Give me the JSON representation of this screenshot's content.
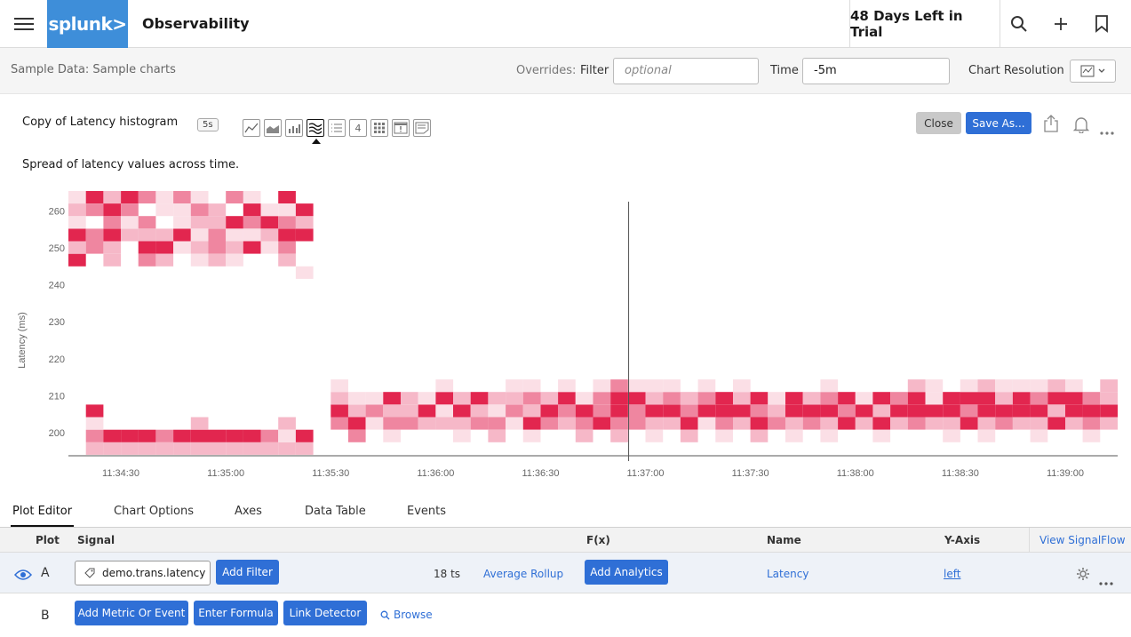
{
  "topbar": {
    "logo_text": "splunk>",
    "app_title": "Observability",
    "trial_text": "48 Days Left in Trial",
    "icons": [
      "menu-icon",
      "search-icon",
      "plus-icon",
      "bookmark-icon"
    ]
  },
  "subbar": {
    "breadcrumb": "Sample Data: Sample charts",
    "overrides_label": "Overrides:",
    "filter_label": "Filter",
    "filter_placeholder": "optional",
    "time_label": "Time",
    "time_value": "-5m",
    "resolution_label": "Chart Resolution"
  },
  "chart_header": {
    "title": "Copy of Latency histogram",
    "refresh_badge": "5s",
    "chart_types": [
      "line",
      "area",
      "column",
      "histogram",
      "list",
      "single-value",
      "heatmap",
      "event-feed",
      "text"
    ],
    "single_value_glyph": "4",
    "active_chart_type": "histogram",
    "description": "Spread of latency values across time.",
    "close_label": "Close",
    "save_as_label": "Save As..."
  },
  "chart_data": {
    "type": "heatmap",
    "title": "Copy of Latency histogram",
    "xlabel": "",
    "ylabel": "Latency (ms)",
    "ylim": [
      194,
      263
    ],
    "y_ticks": [
      200,
      210,
      220,
      230,
      240,
      250,
      260
    ],
    "x_ticks": [
      "11:34:30",
      "11:35:00",
      "11:35:30",
      "11:36:00",
      "11:36:30",
      "11:37:00",
      "11:37:30",
      "11:38:00",
      "11:38:30",
      "11:39:00"
    ],
    "start_time": "11:34:15",
    "bucket_seconds": 5,
    "bin_ms": 3.4,
    "bin_start_ms": 194,
    "cursor_time": "11:37:00",
    "color_scale": [
      "#ffffff",
      "#fbdfe6",
      "#f6b8c8",
      "#ef86a0",
      "#e2264f"
    ],
    "grid": false,
    "columns": [
      [
        0,
        0,
        0,
        0,
        0,
        0,
        0,
        0,
        0,
        0,
        0,
        0,
        0,
        0,
        0,
        4,
        2,
        4,
        1,
        2,
        1
      ],
      [
        2,
        3,
        1,
        4,
        0,
        0,
        0,
        0,
        0,
        0,
        0,
        0,
        0,
        0,
        0,
        0,
        3,
        3,
        0,
        3,
        4
      ],
      [
        2,
        4,
        0,
        0,
        0,
        0,
        0,
        0,
        0,
        0,
        0,
        0,
        0,
        0,
        0,
        2,
        2,
        4,
        3,
        4,
        2
      ],
      [
        2,
        4,
        0,
        0,
        0,
        0,
        0,
        0,
        0,
        0,
        0,
        0,
        0,
        0,
        0,
        0,
        0,
        2,
        1,
        3,
        4
      ],
      [
        2,
        4,
        0,
        0,
        0,
        0,
        0,
        0,
        0,
        0,
        0,
        0,
        0,
        0,
        0,
        3,
        4,
        2,
        3,
        0,
        3
      ],
      [
        2,
        3,
        0,
        0,
        0,
        0,
        0,
        0,
        0,
        0,
        0,
        0,
        0,
        0,
        0,
        2,
        4,
        2,
        0,
        1,
        1
      ],
      [
        2,
        4,
        0,
        0,
        0,
        0,
        0,
        0,
        0,
        0,
        0,
        0,
        0,
        0,
        0,
        0,
        1,
        4,
        1,
        1,
        3
      ],
      [
        2,
        4,
        2,
        0,
        0,
        0,
        0,
        0,
        0,
        0,
        0,
        0,
        0,
        0,
        0,
        1,
        2,
        1,
        2,
        3,
        1
      ],
      [
        2,
        4,
        0,
        0,
        0,
        0,
        0,
        0,
        0,
        0,
        0,
        0,
        0,
        0,
        0,
        2,
        3,
        3,
        2,
        2,
        0
      ],
      [
        2,
        4,
        0,
        0,
        0,
        0,
        0,
        0,
        0,
        0,
        0,
        0,
        0,
        0,
        0,
        1,
        2,
        1,
        4,
        0,
        3
      ],
      [
        2,
        4,
        0,
        0,
        0,
        0,
        0,
        0,
        0,
        0,
        0,
        0,
        0,
        0,
        0,
        0,
        4,
        1,
        3,
        4,
        1
      ],
      [
        2,
        3,
        0,
        0,
        0,
        0,
        0,
        0,
        0,
        0,
        0,
        0,
        0,
        0,
        0,
        0,
        1,
        2,
        4,
        1,
        0
      ],
      [
        2,
        1,
        2,
        0,
        0,
        0,
        0,
        0,
        0,
        0,
        0,
        0,
        0,
        0,
        0,
        2,
        3,
        4,
        3,
        1,
        4
      ],
      [
        2,
        4,
        0,
        0,
        0,
        0,
        0,
        0,
        0,
        0,
        0,
        0,
        0,
        0,
        1,
        0,
        0,
        4,
        2,
        4,
        0
      ],
      [
        0,
        0,
        0,
        0,
        0,
        0,
        0,
        0,
        0,
        0,
        0,
        0,
        0,
        0,
        0,
        0,
        0,
        0,
        0,
        0,
        0
      ],
      [
        0,
        0,
        3,
        4,
        2,
        1,
        0,
        0,
        0,
        0,
        0,
        0,
        0,
        0,
        0,
        0,
        0,
        0,
        0,
        0,
        0
      ],
      [
        0,
        3,
        4,
        2,
        1,
        0,
        0,
        0,
        0,
        0,
        0,
        0,
        0,
        0,
        0,
        0,
        0,
        0,
        0,
        0,
        0
      ],
      [
        0,
        0,
        1,
        3,
        1,
        0,
        0,
        0,
        0,
        0,
        0,
        0,
        0,
        0,
        0,
        0,
        0,
        0,
        0,
        0,
        0
      ],
      [
        0,
        1,
        3,
        2,
        4,
        0,
        0,
        0,
        0,
        0,
        0,
        0,
        0,
        0,
        0,
        0,
        0,
        0,
        0,
        0,
        0
      ],
      [
        0,
        0,
        3,
        2,
        2,
        0,
        0,
        0,
        0,
        0,
        0,
        0,
        0,
        0,
        0,
        0,
        0,
        0,
        0,
        0,
        0
      ],
      [
        0,
        0,
        2,
        4,
        1,
        0,
        0,
        0,
        0,
        0,
        0,
        0,
        0,
        0,
        0,
        0,
        0,
        0,
        0,
        0,
        0
      ],
      [
        0,
        0,
        2,
        1,
        4,
        1,
        0,
        0,
        0,
        0,
        0,
        0,
        0,
        0,
        0,
        0,
        0,
        0,
        0,
        0,
        0
      ],
      [
        0,
        1,
        2,
        4,
        2,
        0,
        0,
        0,
        0,
        0,
        0,
        0,
        0,
        0,
        0,
        0,
        0,
        0,
        0,
        0,
        0
      ],
      [
        0,
        0,
        3,
        2,
        4,
        0,
        0,
        0,
        0,
        0,
        0,
        0,
        0,
        0,
        0,
        0,
        0,
        0,
        0,
        0,
        0
      ],
      [
        0,
        2,
        3,
        1,
        2,
        0,
        0,
        0,
        0,
        0,
        0,
        0,
        0,
        0,
        0,
        0,
        0,
        0,
        0,
        0,
        0
      ],
      [
        0,
        0,
        1,
        3,
        2,
        1,
        0,
        0,
        0,
        0,
        0,
        0,
        0,
        0,
        0,
        0,
        0,
        0,
        0,
        0,
        0
      ],
      [
        0,
        1,
        4,
        2,
        3,
        1,
        0,
        0,
        0,
        0,
        0,
        0,
        0,
        0,
        0,
        0,
        0,
        0,
        0,
        0,
        0
      ],
      [
        0,
        0,
        3,
        4,
        2,
        0,
        0,
        0,
        0,
        0,
        0,
        0,
        0,
        0,
        0,
        0,
        0,
        0,
        0,
        0,
        0
      ],
      [
        0,
        0,
        2,
        3,
        4,
        1,
        0,
        0,
        0,
        0,
        0,
        0,
        0,
        0,
        0,
        0,
        0,
        0,
        0,
        0,
        0
      ],
      [
        0,
        2,
        3,
        4,
        1,
        0,
        0,
        0,
        0,
        0,
        0,
        0,
        0,
        0,
        0,
        0,
        0,
        0,
        0,
        0,
        0
      ],
      [
        0,
        0,
        4,
        3,
        3,
        1,
        0,
        0,
        0,
        0,
        0,
        0,
        0,
        0,
        0,
        0,
        0,
        0,
        0,
        0,
        0
      ],
      [
        0,
        2,
        3,
        4,
        4,
        3,
        0,
        0,
        0,
        0,
        0,
        0,
        0,
        0,
        0,
        0,
        0,
        0,
        0,
        0,
        0
      ],
      [
        0,
        0,
        3,
        3,
        4,
        1,
        0,
        0,
        0,
        0,
        0,
        0,
        0,
        0,
        0,
        0,
        0,
        0,
        0,
        0,
        0
      ],
      [
        0,
        1,
        2,
        4,
        2,
        1,
        0,
        0,
        0,
        0,
        0,
        0,
        0,
        0,
        0,
        0,
        0,
        0,
        0,
        0,
        0
      ],
      [
        0,
        0,
        2,
        4,
        3,
        1,
        0,
        0,
        0,
        0,
        0,
        0,
        0,
        0,
        0,
        0,
        0,
        0,
        0,
        0,
        0
      ],
      [
        0,
        2,
        4,
        3,
        2,
        0,
        0,
        0,
        0,
        0,
        0,
        0,
        0,
        0,
        0,
        0,
        0,
        0,
        0,
        0,
        0
      ],
      [
        0,
        0,
        1,
        4,
        3,
        1,
        0,
        0,
        0,
        0,
        0,
        0,
        0,
        0,
        0,
        0,
        0,
        0,
        0,
        0,
        0
      ],
      [
        0,
        1,
        3,
        4,
        4,
        0,
        0,
        0,
        0,
        0,
        0,
        0,
        0,
        0,
        0,
        0,
        0,
        0,
        0,
        0,
        0
      ],
      [
        0,
        0,
        2,
        4,
        2,
        1,
        0,
        0,
        0,
        0,
        0,
        0,
        0,
        0,
        0,
        0,
        0,
        0,
        0,
        0,
        0
      ],
      [
        0,
        2,
        4,
        3,
        4,
        0,
        0,
        0,
        0,
        0,
        0,
        0,
        0,
        0,
        0,
        0,
        0,
        0,
        0,
        0,
        0
      ],
      [
        0,
        0,
        3,
        2,
        1,
        0,
        0,
        0,
        0,
        0,
        0,
        0,
        0,
        0,
        0,
        0,
        0,
        0,
        0,
        0,
        0
      ],
      [
        0,
        1,
        2,
        4,
        4,
        0,
        0,
        0,
        0,
        0,
        0,
        0,
        0,
        0,
        0,
        0,
        0,
        0,
        0,
        0,
        0
      ],
      [
        0,
        0,
        3,
        4,
        2,
        0,
        0,
        0,
        0,
        0,
        0,
        0,
        0,
        0,
        0,
        0,
        0,
        0,
        0,
        0,
        0
      ],
      [
        0,
        1,
        2,
        4,
        3,
        1,
        0,
        0,
        0,
        0,
        0,
        0,
        0,
        0,
        0,
        0,
        0,
        0,
        0,
        0,
        0
      ],
      [
        0,
        0,
        4,
        3,
        4,
        0,
        0,
        0,
        0,
        0,
        0,
        0,
        0,
        0,
        0,
        0,
        0,
        0,
        0,
        0,
        0
      ],
      [
        0,
        0,
        2,
        4,
        1,
        0,
        0,
        0,
        0,
        0,
        0,
        0,
        0,
        0,
        0,
        0,
        0,
        0,
        0,
        0,
        0
      ],
      [
        0,
        1,
        4,
        2,
        4,
        0,
        0,
        0,
        0,
        0,
        0,
        0,
        0,
        0,
        0,
        0,
        0,
        0,
        0,
        0,
        0
      ],
      [
        0,
        0,
        2,
        4,
        3,
        0,
        0,
        0,
        0,
        0,
        0,
        0,
        0,
        0,
        0,
        0,
        0,
        0,
        0,
        0,
        0
      ],
      [
        0,
        0,
        3,
        4,
        4,
        2,
        0,
        0,
        0,
        0,
        0,
        0,
        0,
        0,
        0,
        0,
        0,
        0,
        0,
        0,
        0
      ],
      [
        0,
        0,
        2,
        4,
        1,
        1,
        0,
        0,
        0,
        0,
        0,
        0,
        0,
        0,
        0,
        0,
        0,
        0,
        0,
        0,
        0
      ],
      [
        0,
        1,
        2,
        4,
        4,
        0,
        0,
        0,
        0,
        0,
        0,
        0,
        0,
        0,
        0,
        0,
        0,
        0,
        0,
        0,
        0
      ],
      [
        0,
        0,
        4,
        3,
        4,
        1,
        0,
        0,
        0,
        0,
        0,
        0,
        0,
        0,
        0,
        0,
        0,
        0,
        0,
        0,
        0
      ],
      [
        0,
        1,
        2,
        4,
        4,
        2,
        0,
        0,
        0,
        0,
        0,
        0,
        0,
        0,
        0,
        0,
        0,
        0,
        0,
        0,
        0
      ],
      [
        0,
        0,
        3,
        4,
        2,
        1,
        0,
        0,
        0,
        0,
        0,
        0,
        0,
        0,
        0,
        0,
        0,
        0,
        0,
        0,
        0
      ],
      [
        0,
        0,
        2,
        4,
        4,
        1,
        0,
        0,
        0,
        0,
        0,
        0,
        0,
        0,
        0,
        0,
        0,
        0,
        0,
        0,
        0
      ],
      [
        0,
        1,
        2,
        4,
        3,
        1,
        0,
        0,
        0,
        0,
        0,
        0,
        0,
        0,
        0,
        0,
        0,
        0,
        0,
        0,
        0
      ],
      [
        0,
        0,
        4,
        2,
        4,
        2,
        0,
        0,
        0,
        0,
        0,
        0,
        0,
        0,
        0,
        0,
        0,
        0,
        0,
        0,
        0
      ],
      [
        0,
        0,
        2,
        4,
        4,
        1,
        0,
        0,
        0,
        0,
        0,
        0,
        0,
        0,
        0,
        0,
        0,
        0,
        0,
        0,
        0
      ],
      [
        0,
        1,
        3,
        4,
        3,
        0,
        0,
        0,
        0,
        0,
        0,
        0,
        0,
        0,
        0,
        0,
        0,
        0,
        0,
        0,
        0
      ],
      [
        0,
        0,
        2,
        4,
        2,
        2,
        0,
        0,
        0,
        0,
        0,
        0,
        0,
        0,
        0,
        0,
        0,
        0,
        0,
        0,
        0
      ]
    ]
  },
  "tabs": [
    {
      "label": "Plot Editor",
      "active": true
    },
    {
      "label": "Chart Options",
      "active": false
    },
    {
      "label": "Axes",
      "active": false
    },
    {
      "label": "Data Table",
      "active": false
    },
    {
      "label": "Events",
      "active": false
    }
  ],
  "table": {
    "headers": {
      "plot": "Plot",
      "signal": "Signal",
      "fx": "F(x)",
      "name": "Name",
      "yaxis": "Y-Axis"
    },
    "view_signalflow": "View SignalFlow",
    "rows": [
      {
        "letter": "A",
        "signal": "demo.trans.latency",
        "add_filter": "Add Filter",
        "ts_count": "18 ts",
        "rollup": "Average Rollup",
        "add_analytics": "Add Analytics",
        "name": "Latency",
        "yaxis": "left"
      },
      {
        "letter": "B",
        "add_metric": "Add Metric Or Event",
        "enter_formula": "Enter Formula",
        "link_detector": "Link Detector",
        "browse": "Browse"
      }
    ]
  }
}
